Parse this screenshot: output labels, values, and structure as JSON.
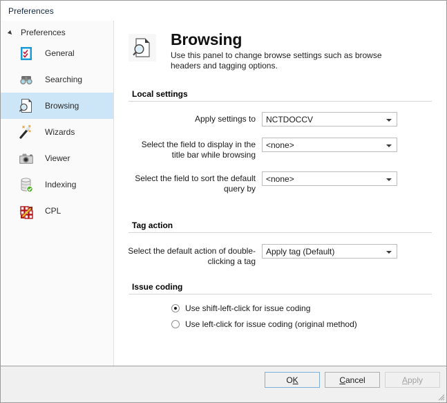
{
  "window": {
    "title": "Preferences"
  },
  "sidebar": {
    "root_label": "Preferences",
    "items": [
      {
        "label": "General",
        "icon": "checklist-icon",
        "selected": false
      },
      {
        "label": "Searching",
        "icon": "binoculars-icon",
        "selected": false
      },
      {
        "label": "Browsing",
        "icon": "document-search-icon",
        "selected": true
      },
      {
        "label": "Wizards",
        "icon": "magic-wand-icon",
        "selected": false
      },
      {
        "label": "Viewer",
        "icon": "camera-icon",
        "selected": false
      },
      {
        "label": "Indexing",
        "icon": "database-check-icon",
        "selected": false
      },
      {
        "label": "CPL",
        "icon": "grid-blocks-icon",
        "selected": false
      }
    ]
  },
  "header": {
    "icon": "document-search-icon",
    "title": "Browsing",
    "description": "Use this panel to change browse settings such as browse headers and tagging options."
  },
  "sections": [
    {
      "title": "Local settings",
      "fields": [
        {
          "label": "Apply settings to",
          "value": "NCTDOCCV"
        },
        {
          "label": "Select the field to display in the title bar while browsing",
          "value": "<none>"
        },
        {
          "label": "Select the field to sort the default query by",
          "value": "<none>"
        }
      ]
    },
    {
      "title": "Tag action",
      "fields": [
        {
          "label": "Select the default action of double-clicking a tag",
          "value": "Apply tag (Default)"
        }
      ]
    },
    {
      "title": "Issue coding",
      "radios": [
        {
          "label": "Use shift-left-click for issue coding",
          "checked": true
        },
        {
          "label": "Use left-click for issue coding (original method)",
          "checked": false
        }
      ]
    }
  ],
  "footer": {
    "buttons": [
      {
        "id": "ok",
        "pre": "O",
        "accel": "K",
        "post": "",
        "state": "default"
      },
      {
        "id": "cancel",
        "pre": "",
        "accel": "C",
        "post": "ancel",
        "state": "normal"
      },
      {
        "id": "apply",
        "pre": "",
        "accel": "A",
        "post": "pply",
        "state": "disabled"
      }
    ]
  },
  "colors": {
    "selection": "#cce6f7",
    "panel": "#f0f0f0",
    "sidebar": "#fafafa",
    "rule": "#d4d4d4"
  }
}
